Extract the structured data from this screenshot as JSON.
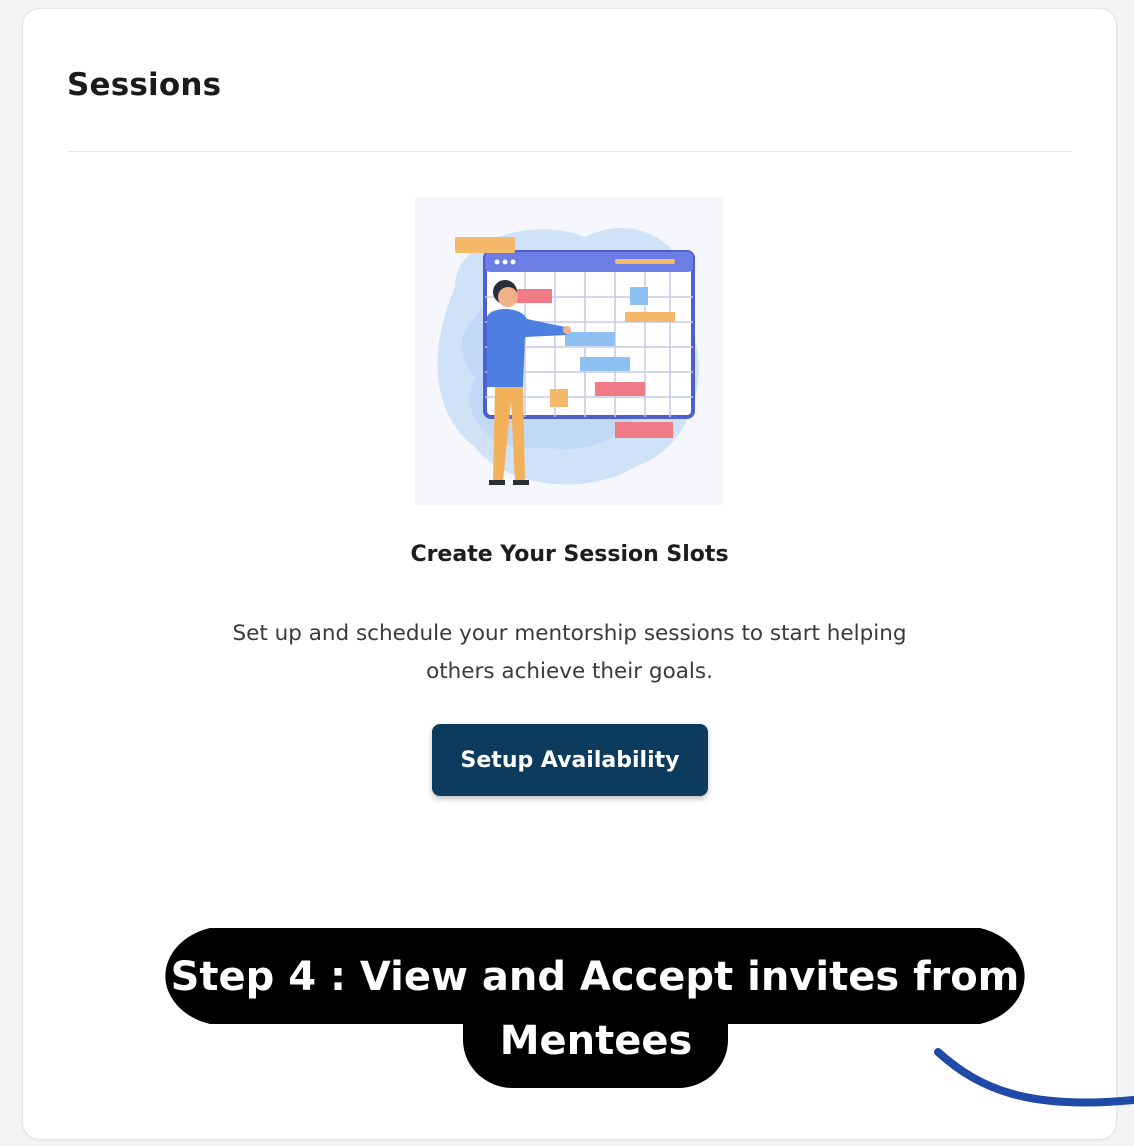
{
  "card": {
    "title": "Sessions"
  },
  "empty_state": {
    "heading": "Create Your Session Slots",
    "description": "Set up and schedule your mentorship sessions to start helping others achieve their goals.",
    "illustration_icon": "calendar-planning-illustration"
  },
  "actions": {
    "setup_label": "Setup Availability"
  },
  "annotation": {
    "caption_line1": "Step 4 : View and Accept invites from",
    "caption_line2": "Mentees",
    "arrow_icon": "curved-arrow-icon"
  },
  "colors": {
    "primary_button": "#0d3b5e",
    "caption_bg": "#000000",
    "arrow": "#1f4aa8"
  }
}
